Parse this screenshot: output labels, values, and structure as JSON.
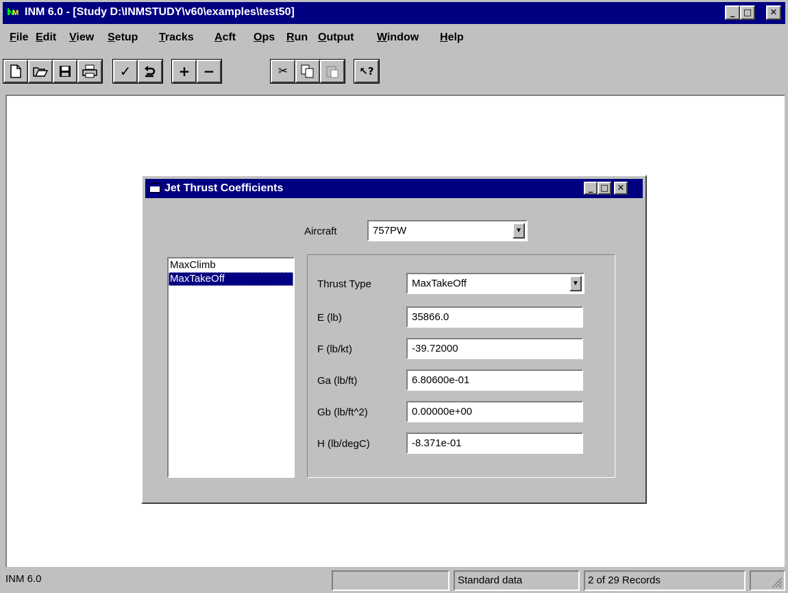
{
  "app": {
    "title": "INM 6.0 - [Study D:\\INMSTUDY\\v60\\examples\\test50]",
    "icon_text": "I",
    "icon_text2": "N",
    "icon_text3": "M"
  },
  "menu": [
    "File",
    "Edit",
    "View",
    "Setup",
    "Tracks",
    "Acft",
    "Ops",
    "Run",
    "Output",
    "Window",
    "Help"
  ],
  "toolbar": {
    "icons": [
      "new-file-icon",
      "open-folder-icon",
      "save-icon",
      "print-icon",
      "check-icon",
      "undo-icon",
      "plus-icon",
      "minus-icon",
      "cut-icon",
      "copy-icon",
      "paste-icon",
      "context-help-icon"
    ]
  },
  "dialog": {
    "title": "Jet Thrust Coefficients",
    "aircraft_label": "Aircraft",
    "aircraft_value": "757PW",
    "list_items": [
      "MaxClimb",
      "MaxTakeOff"
    ],
    "selected_item": "MaxTakeOff",
    "thrust_type_label": "Thrust Type",
    "thrust_type_value": "MaxTakeOff",
    "fields": [
      {
        "label": "E (lb)",
        "value": "35866.0"
      },
      {
        "label": "F (lb/kt)",
        "value": "-39.72000"
      },
      {
        "label": "Ga (lb/ft)",
        "value": "6.80600e-01"
      },
      {
        "label": "Gb (lb/ft^2)",
        "value": "0.00000e+00"
      },
      {
        "label": "H (lb/degC)",
        "value": "-8.371e-01"
      }
    ]
  },
  "status": {
    "app_name": "INM 6.0",
    "data_source": "Standard data",
    "records": "2 of 29 Records"
  },
  "colors": {
    "titlebar": "#000080",
    "face": "#c0c0c0",
    "selection": "#000080"
  }
}
